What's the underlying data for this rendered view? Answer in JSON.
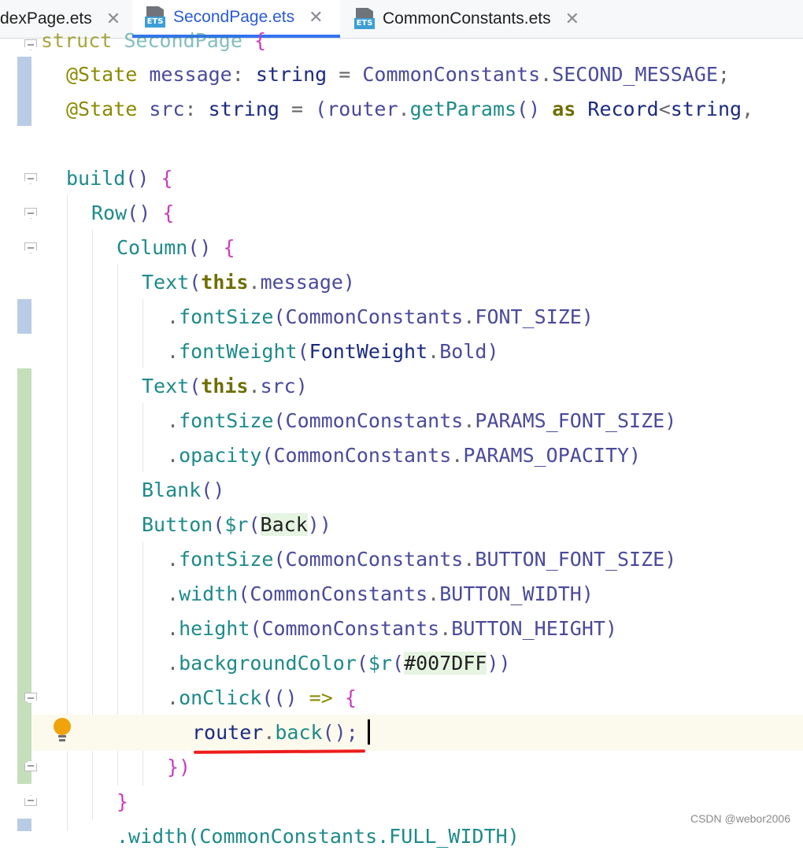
{
  "tabs": [
    {
      "label": "dexPage.ets",
      "active": false,
      "icon": "close-icon"
    },
    {
      "label": "SecondPage.ets",
      "active": true,
      "file_icon": "ets-file-icon",
      "icon": "close-icon"
    },
    {
      "label": "CommonConstants.ets",
      "active": false,
      "file_icon": "ets-file-icon",
      "icon": "close-icon"
    }
  ],
  "file_badge": "ETS",
  "code": {
    "l0": {
      "a": "struct",
      "b": "SecondPage",
      "c": "{"
    },
    "l1": {
      "a": "@State",
      "b": "message",
      "c": ":",
      "d": "string",
      "e": "=",
      "f": "CommonConstants",
      "g": ".",
      "h": "SECOND_MESSAGE",
      "i": ";"
    },
    "l2": {
      "a": "@State",
      "b": "src",
      "c": ":",
      "d": "string",
      "e": "=",
      "f": "(",
      "g": "router",
      "h": ".",
      "i": "getParams",
      "j": "()",
      "k": "as",
      "l": "Record",
      "m": "<",
      "n": "string",
      ",": ","
    },
    "l4": {
      "a": "build",
      "b": "()",
      "c": "{"
    },
    "l5": {
      "a": "Row",
      "b": "()",
      "c": "{"
    },
    "l6": {
      "a": "Column",
      "b": "()",
      "c": "{"
    },
    "l7": {
      "a": "Text",
      "b": "(",
      "c": "this",
      "d": ".",
      "e": "message",
      "f": ")"
    },
    "l8": {
      "a": ".",
      "b": "fontSize",
      "c": "(",
      "d": "CommonConstants",
      "e": ".",
      "f": "FONT_SIZE",
      "g": ")"
    },
    "l9": {
      "a": ".",
      "b": "fontWeight",
      "c": "(",
      "d": "FontWeight",
      "e": ".",
      "f": "Bold",
      "g": ")"
    },
    "l10": {
      "a": "Text",
      "b": "(",
      "c": "this",
      "d": ".",
      "e": "src",
      "f": ")"
    },
    "l11": {
      "a": ".",
      "b": "fontSize",
      "c": "(",
      "d": "CommonConstants",
      "e": ".",
      "f": "PARAMS_FONT_SIZE",
      "g": ")"
    },
    "l12": {
      "a": ".",
      "b": "opacity",
      "c": "(",
      "d": "CommonConstants",
      "e": ".",
      "f": "PARAMS_OPACITY",
      "g": ")"
    },
    "l13": {
      "a": "Blank",
      "b": "()"
    },
    "l14": {
      "a": "Button",
      "b": "(",
      "c": "$r",
      "d": "(",
      "e": "Back",
      "f": "))"
    },
    "l15": {
      "a": ".",
      "b": "fontSize",
      "c": "(",
      "d": "CommonConstants",
      "e": ".",
      "f": "BUTTON_FONT_SIZE",
      "g": ")"
    },
    "l16": {
      "a": ".",
      "b": "width",
      "c": "(",
      "d": "CommonConstants",
      "e": ".",
      "f": "BUTTON_WIDTH",
      "g": ")"
    },
    "l17": {
      "a": ".",
      "b": "height",
      "c": "(",
      "d": "CommonConstants",
      "e": ".",
      "f": "BUTTON_HEIGHT",
      "g": ")"
    },
    "l18": {
      "a": ".",
      "b": "backgroundColor",
      "c": "(",
      "d": "$r",
      "e": "(",
      "f": "#007DFF",
      "g": "))"
    },
    "l19": {
      "a": ".",
      "b": "onClick",
      "c": "((",
      "d": ")",
      "e": "=>",
      "f": "{"
    },
    "l20": {
      "a": "router",
      "b": ".",
      "c": "back",
      "d": "();"
    },
    "l21": {
      "a": "})"
    },
    "l22": {
      "a": "}"
    },
    "l23": {
      "a": ".width(CommonConstants.FULL_WIDTH)"
    }
  },
  "watermark": "CSDN @webor2006",
  "colors": {
    "accent": "#3574f0",
    "annotation": "#ee1c1c",
    "intention_bulb": "#f0a30a"
  }
}
